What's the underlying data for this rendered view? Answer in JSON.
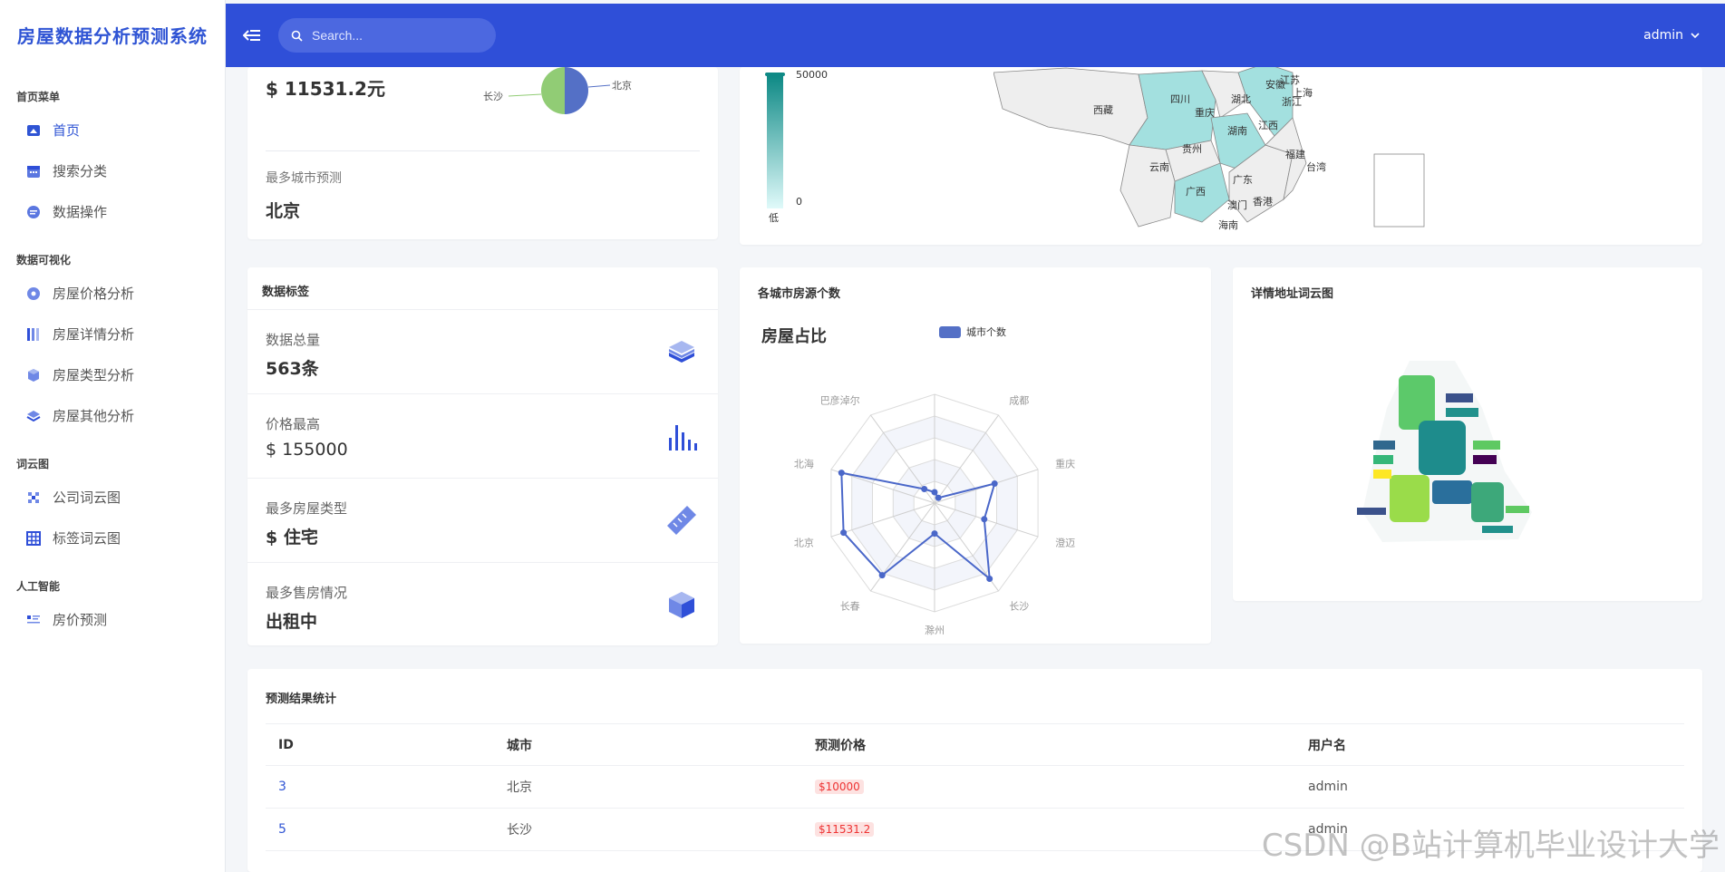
{
  "app": {
    "brand": "房屋数据分析预测系统"
  },
  "topbar": {
    "search_placeholder": "Search...",
    "user": "admin"
  },
  "sidebar": {
    "groups": [
      {
        "label": "首页菜单",
        "items": [
          {
            "label": "首页",
            "icon": "home-icon",
            "active": true
          },
          {
            "label": "搜索分类",
            "icon": "calendar-icon"
          },
          {
            "label": "数据操作",
            "icon": "chat-icon"
          }
        ]
      },
      {
        "label": "数据可视化",
        "items": [
          {
            "label": "房屋价格分析",
            "icon": "circle-icon"
          },
          {
            "label": "房屋详情分析",
            "icon": "columns-icon"
          },
          {
            "label": "房屋类型分析",
            "icon": "cube-icon"
          },
          {
            "label": "房屋其他分析",
            "icon": "layers-icon"
          }
        ]
      },
      {
        "label": "词云图",
        "items": [
          {
            "label": "公司词云图",
            "icon": "grid-dots-icon"
          },
          {
            "label": "标签词云图",
            "icon": "table-icon"
          }
        ]
      },
      {
        "label": "人工智能",
        "items": [
          {
            "label": "房价预测",
            "icon": "list-icon"
          }
        ]
      }
    ]
  },
  "top_card": {
    "price_value": "$ 11531.2元",
    "pie_labels": {
      "left": "长沙",
      "right": "北京"
    },
    "city_label": "最多城市预测",
    "city_value": "北京"
  },
  "map_card": {
    "legend_max": "50000",
    "legend_min": "0",
    "legend_low": "低",
    "provinces": [
      "四川",
      "重庆",
      "湖北",
      "安徽",
      "江苏",
      "上海",
      "浙江",
      "西藏",
      "湖南",
      "江西",
      "贵州",
      "云南",
      "广西",
      "广东",
      "福建",
      "台湾",
      "香港",
      "澳门",
      "海南"
    ]
  },
  "data_tags": {
    "title": "数据标签",
    "rows": [
      {
        "label": "数据总量",
        "value": "563条",
        "icon": "layers-stack-icon"
      },
      {
        "label": "价格最高",
        "value": "$ 155000",
        "icon": "bar-chart-icon"
      },
      {
        "label": "最多房屋类型",
        "value": "$ 住宅",
        "icon": "ruler-icon"
      },
      {
        "label": "最多售房情况",
        "value": "出租中",
        "icon": "box-icon"
      }
    ]
  },
  "radar_card": {
    "title": "各城市房源个数",
    "subtitle": "房屋占比",
    "legend": "城市个数"
  },
  "colors": {
    "accent": "#2f4fd8",
    "radar_line": "#4a67c9"
  },
  "chart_data": {
    "type": "radar",
    "title": "房屋占比",
    "indicators": [
      "",
      "成都",
      "重庆",
      "澄迈",
      "长沙",
      "滁州",
      "长春",
      "北京",
      "北海",
      "巴彦淖尔"
    ],
    "series": [
      {
        "name": "城市个数",
        "values": [
          10,
          6,
          58,
          48,
          86,
          28,
          82,
          88,
          90,
          16
        ]
      }
    ],
    "max": 100
  },
  "wordcloud_card": {
    "title": "详情地址词云图"
  },
  "prediction_table": {
    "title": "预测结果统计",
    "headers": [
      "ID",
      "城市",
      "预测价格",
      "用户名"
    ],
    "rows": [
      {
        "id": "3",
        "city": "北京",
        "price": "$10000",
        "user": "admin"
      },
      {
        "id": "5",
        "city": "长沙",
        "price": "$11531.2",
        "user": "admin"
      }
    ]
  },
  "watermark": "CSDN @B站计算机毕业设计大学"
}
